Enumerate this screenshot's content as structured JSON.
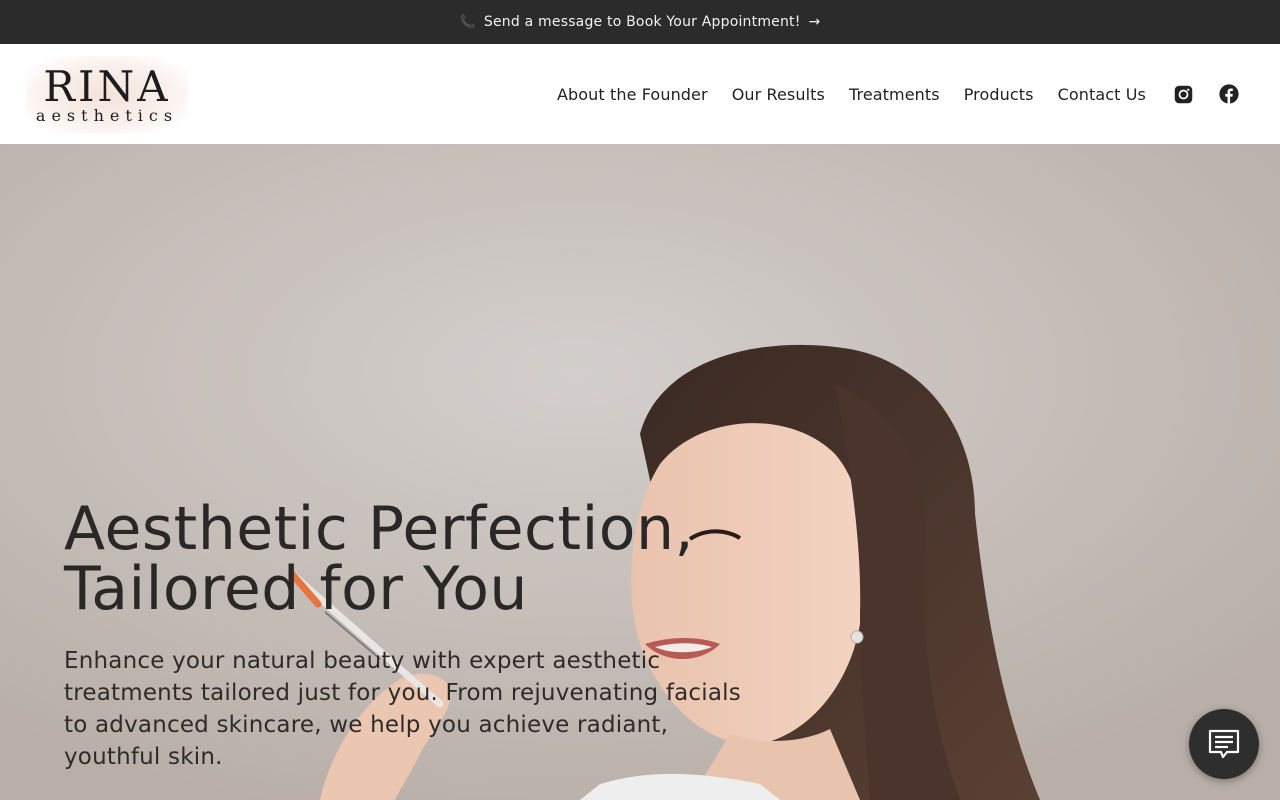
{
  "announcement": {
    "icon": "phone-icon",
    "text": "Send a message to Book Your Appointment!",
    "arrow": "→"
  },
  "header": {
    "logo_main": "RINA",
    "logo_sub": "aesthetics",
    "nav": [
      {
        "label": "About the Founder"
      },
      {
        "label": "Our Results"
      },
      {
        "label": "Treatments"
      },
      {
        "label": "Products"
      },
      {
        "label": "Contact Us"
      }
    ],
    "social_icons": [
      "instagram-icon",
      "facebook-icon"
    ]
  },
  "hero": {
    "title_line1": "Aesthetic Perfection,",
    "title_line2": "Tailored for You",
    "text": "Enhance your natural beauty with expert aesthetic treatments tailored just for you. From rejuvenating facials to advanced skincare, we help you achieve radiant, youthful skin."
  },
  "chat": {
    "icon": "chat-icon"
  },
  "colors": {
    "announcement_bg": "#2b2b2b",
    "hero_bg": "#c6bfbb",
    "text_dark": "#2a2826",
    "chat_bg": "#2e2e2e"
  }
}
